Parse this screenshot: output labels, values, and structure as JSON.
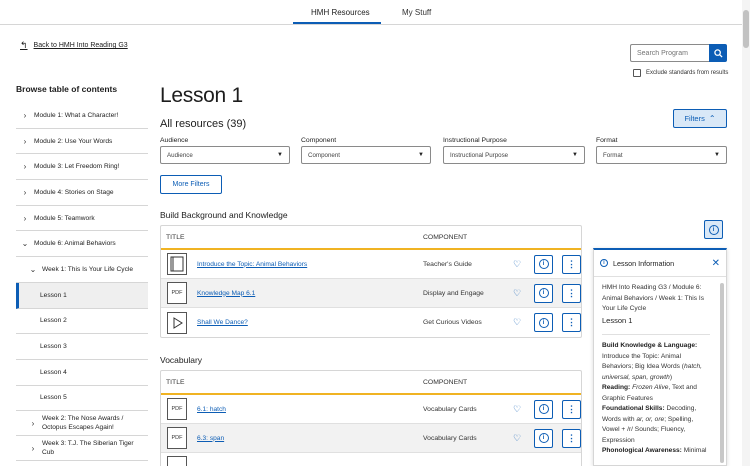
{
  "topnav": {
    "tabs": [
      "HMH Resources",
      "My Stuff"
    ]
  },
  "back_link": "Back to HMH Into Reading G3",
  "search": {
    "placeholder": "Search Program",
    "exclude_label": "Exclude standards from results"
  },
  "sidebar": {
    "title": "Browse table of contents",
    "modules": [
      "Module 1: What a Character!",
      "Module 2: Use Your Words",
      "Module 3: Let Freedom Ring!",
      "Module 4: Stories on Stage",
      "Module 5: Teamwork",
      "Module 6: Animal Behaviors"
    ],
    "week1": "Week 1: This Is Your Life Cycle",
    "lessons": [
      "Lesson 1",
      "Lesson 2",
      "Lesson 3",
      "Lesson 4",
      "Lesson 5"
    ],
    "week2": "Week 2: The Nose Awards / Octopus Escapes Again!",
    "week3": "Week 3: T.J. The Siberian Tiger Cub"
  },
  "main": {
    "title": "Lesson 1",
    "all_resources": "All resources (39)",
    "filters_button": "Filters",
    "more_filters": "More Filters",
    "dropdowns": [
      {
        "label": "Audience",
        "value": "Audience"
      },
      {
        "label": "Component",
        "value": "Component"
      },
      {
        "label": "Instructional Purpose",
        "value": "Instructional Purpose"
      },
      {
        "label": "Format",
        "value": "Format"
      }
    ],
    "col_title": "TITLE",
    "col_component": "COMPONENT",
    "section1": {
      "heading": "Build Background and Knowledge",
      "rows": [
        {
          "title": "Introduce the Topic: Animal Behaviors",
          "component": "Teacher's Guide",
          "thumb": "book"
        },
        {
          "title": "Knowledge Map 6.1",
          "component": "Display and Engage",
          "thumb": "PDF"
        },
        {
          "title": "Shall We Dance?",
          "component": "Get Curious Videos",
          "thumb": "play"
        }
      ]
    },
    "section2": {
      "heading": "Vocabulary",
      "rows": [
        {
          "title": "6.1: hatch",
          "component": "Vocabulary Cards",
          "thumb": "PDF"
        },
        {
          "title": "6.3: span",
          "component": "Vocabulary Cards",
          "thumb": "PDF"
        }
      ]
    }
  },
  "info_panel": {
    "title": "Lesson Information",
    "breadcrumb": "HMH Into Reading G3 / Module 6: Animal Behaviors / Week 1: This Is Your Life Cycle",
    "lesson": "Lesson 1",
    "bk_label": "Build Knowledge & Language:",
    "bk_text_1": "Introduce the Topic: Animal Behaviors; Big Idea Words (",
    "bk_italic": "hatch, universal, span, growth",
    "bk_text_2": ")",
    "reading_label": "Reading:",
    "reading_italic": "Frozen Alive",
    "reading_text": ", Text and Graphic Features",
    "found_label": "Foundational Skills:",
    "found_text_1": "Decoding, Words with ",
    "found_italic": "ar, or, ore",
    "found_text_2": "; Spelling, Vowel + /r/ Sounds; Fluency, Expression",
    "phon_label": "Phonological Awareness:",
    "phon_text": "Minimal"
  },
  "colors": {
    "accent": "#0c5db5",
    "table_rule": "#f0b323"
  },
  "icons": {
    "back": "arrow-left-icon",
    "search": "magnifier-icon",
    "chevron": "chevron-right-icon",
    "heart": "heart-outline-icon",
    "info": "info-circle-icon",
    "more": "vertical-dots-icon",
    "close": "close-x-icon"
  }
}
